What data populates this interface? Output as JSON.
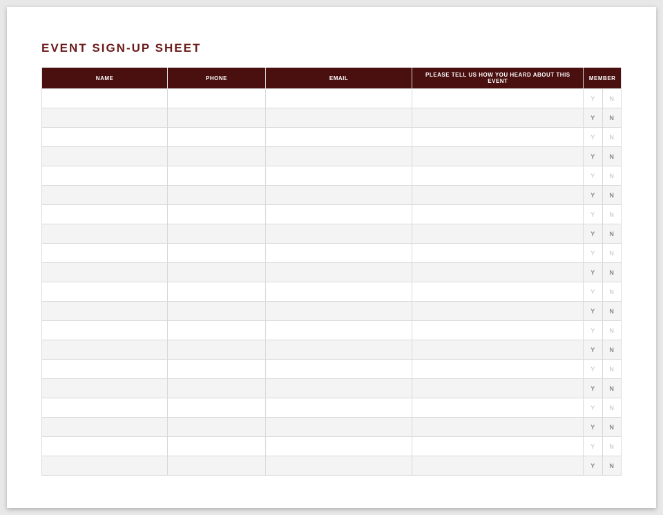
{
  "title": "EVENT SIGN-UP SHEET",
  "headers": {
    "name": "NAME",
    "phone": "PHONE",
    "email": "EMAIL",
    "heard": "PLEASE TELL US HOW YOU HEARD ABOUT THIS EVENT",
    "member": "MEMBER"
  },
  "memberOptions": {
    "yes": "Y",
    "no": "N"
  },
  "rowCount": 20,
  "colors": {
    "headerBg": "#4a0f0f",
    "titleColor": "#6b1a1a",
    "altRow": "#f4f4f4",
    "border": "#d9d9d9"
  }
}
